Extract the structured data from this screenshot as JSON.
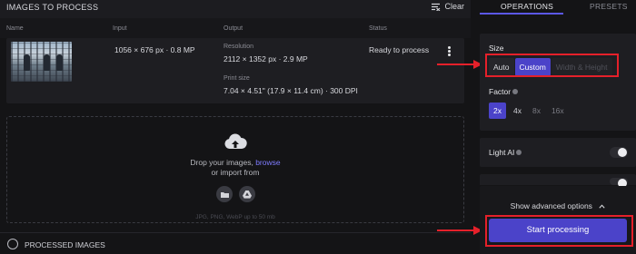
{
  "images_panel": {
    "title": "IMAGES TO PROCESS",
    "clear_label": "Clear",
    "columns": [
      "Name",
      "Input",
      "Output",
      "Status"
    ],
    "row": {
      "input": "1056 × 676 px · 0.8 MP",
      "resolution_label": "Resolution",
      "resolution_value": "2112 × 1352 px · 2.9 MP",
      "print_size_label": "Print size",
      "print_size_value": "7.04 × 4.51\" (17.9 × 11.4 cm) · 300 DPI",
      "status": "Ready to process"
    }
  },
  "dropzone": {
    "text_before_link": "Drop your images, ",
    "browse_link": "browse",
    "text_line2": "or import from",
    "formats": "JPG, PNG, WebP up to 50 mb"
  },
  "processed": {
    "label": "PROCESSED IMAGES"
  },
  "right_panel": {
    "tabs": [
      "OPERATIONS",
      "PRESETS"
    ],
    "active_tab": "OPERATIONS",
    "size": {
      "label": "Size",
      "options": [
        "Auto",
        "Custom",
        "Width & Height"
      ],
      "selected": "Custom"
    },
    "factor": {
      "label": "Factor",
      "options": [
        "2x",
        "4x",
        "8x",
        "16x"
      ],
      "selected": "2x"
    },
    "light_ai": {
      "label": "Light AI",
      "enabled": false
    },
    "advanced_label": "Show advanced options",
    "start_label": "Start processing"
  },
  "colors": {
    "accent": "#4b43c9",
    "link": "#7f7cff",
    "highlight": "#e5202a",
    "background": "#141416",
    "card": "#1e1e22"
  },
  "icons": [
    "clear-list-icon",
    "kebab-menu-icon",
    "cloud-upload-icon",
    "folder-icon",
    "google-drive-icon",
    "info-icon",
    "chevron-up-icon",
    "arrow-right-icon"
  ]
}
